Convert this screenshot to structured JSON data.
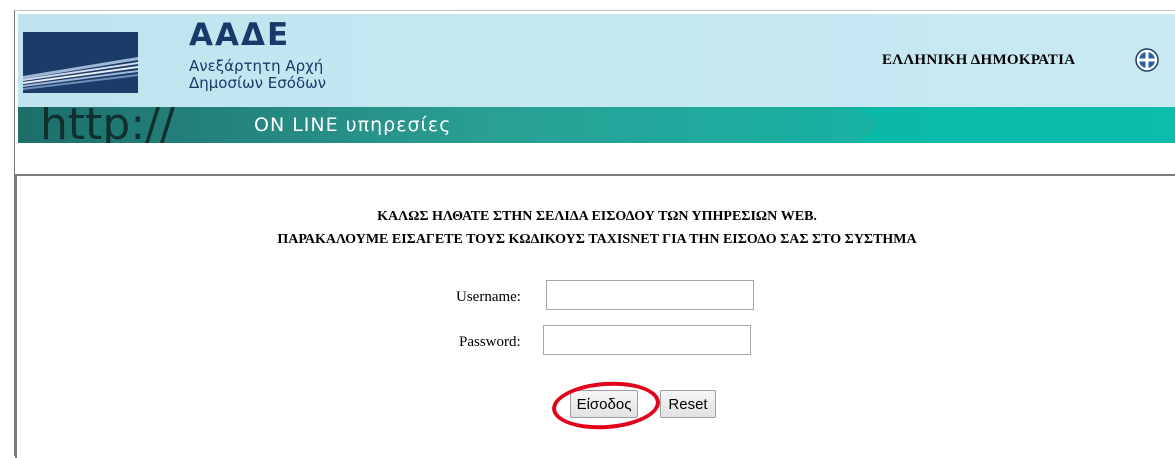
{
  "header": {
    "logo_title": "ΑΑΔΕ",
    "logo_subtitle_line1": "Ανεξάρτητη Αρχή",
    "logo_subtitle_line2": "Δημοσίων Εσόδων",
    "government_label": "ΕΛΛΗΝΙΚΗ ΔΗΜΟΚΡΑΤΙΑ",
    "emblem_icon": "greek-republic-emblem",
    "banner_http": "http://",
    "banner_services": "ON LINE υπηρεσίες"
  },
  "login": {
    "welcome_line1": "ΚΑΛΩΣ ΗΛΘΑΤΕ ΣΤΗΝ ΣΕΛΙΔΑ ΕΙΣΟΔΟΥ ΤΩΝ ΥΠΗΡΕΣΙΩΝ WEB.",
    "welcome_line2": "ΠΑΡΑΚΑΛΟΥΜΕ ΕΙΣΑΓΕΤΕ ΤΟΥΣ ΚΩΔΙΚΟΥΣ TAXISNET ΓΙΑ ΤΗΝ ΕΙΣΟΔΟ ΣΑΣ ΣΤΟ ΣΥΣΤΗΜΑ",
    "username_label": "Username:",
    "username_value": "",
    "password_label": "Password:",
    "password_value": "",
    "login_button": "Είσοδος",
    "reset_button": "Reset"
  },
  "colors": {
    "brand_navy": "#173a6a",
    "banner_teal": "#0ab8a8",
    "highlight_red": "#e3001b"
  }
}
